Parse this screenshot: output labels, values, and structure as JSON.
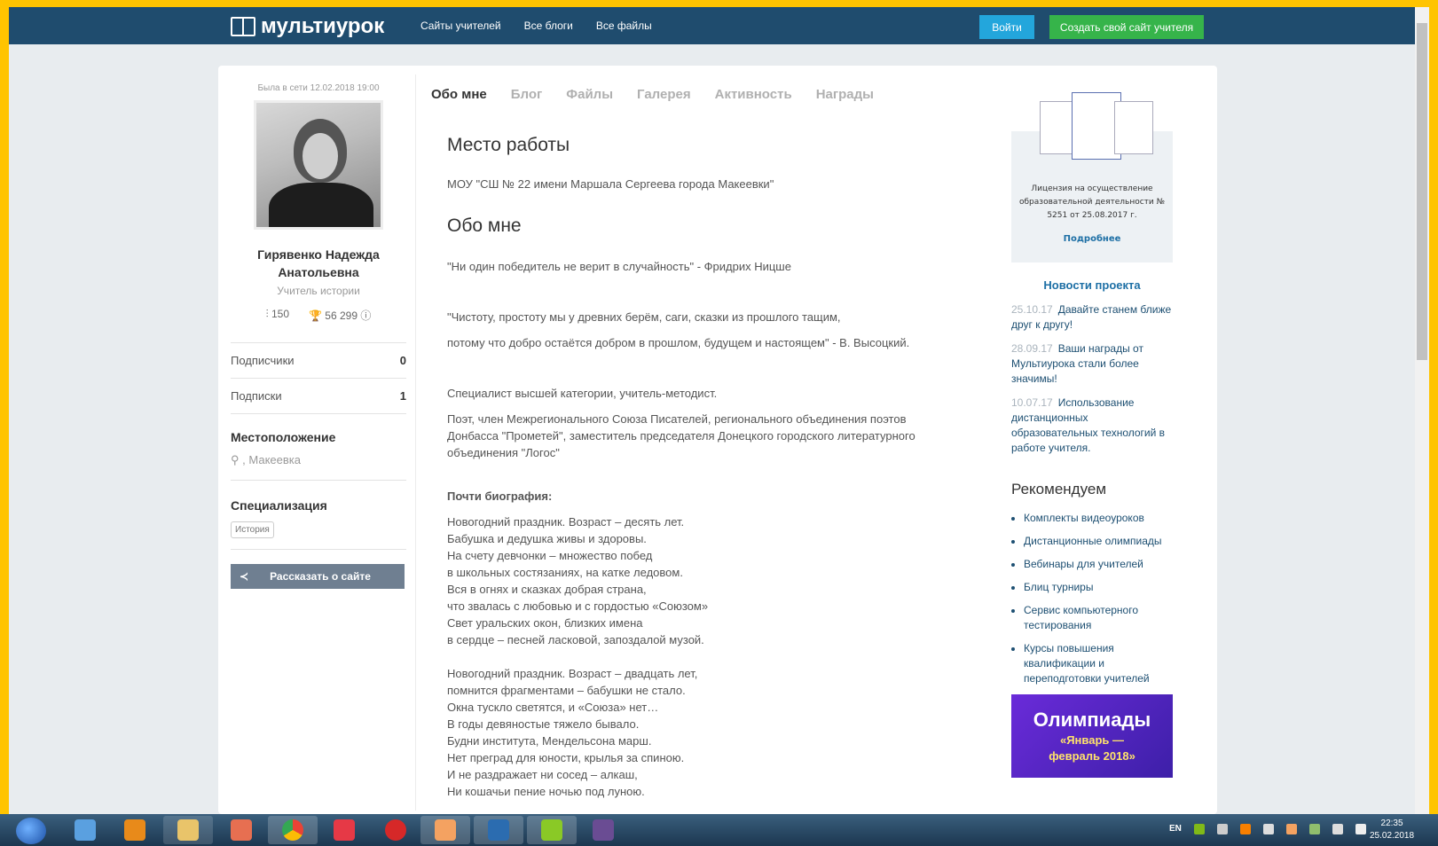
{
  "header": {
    "logo": "мультиурок",
    "nav": [
      "Сайты учителей",
      "Все блоги",
      "Все файлы"
    ],
    "login_label": "Войти",
    "create_label": "Создать свой сайт учителя"
  },
  "profile": {
    "online": "Была в сети 12.02.2018 19:00",
    "name_line1": "Гирявенко Надежда",
    "name_line2": "Анатольевна",
    "role": "Учитель истории",
    "stat_rating": "150",
    "stat_awards": "56 299",
    "subscribers_label": "Подписчики",
    "subscribers_count": "0",
    "subscriptions_label": "Подписки",
    "subscriptions_count": "1",
    "location_title": "Местоположение",
    "location_value": ", Макеевка",
    "spec_title": "Специализация",
    "spec_tag": "История",
    "share_label": "Рассказать о сайте"
  },
  "tabs": [
    "Обо мне",
    "Блог",
    "Файлы",
    "Галерея",
    "Активность",
    "Награды"
  ],
  "main": {
    "work_title": "Место работы",
    "work_value": "МОУ \"СШ № 22 имени Маршала Сергеева города Макеевки\"",
    "about_title": "Обо мне",
    "quote1": " \"Ни один победитель не верит в случайность\" -  Фридрих Ницше",
    "quote2a": " \"Чистоту, простоту мы у древних берём, саги, сказки из прошлого тащим,",
    "quote2b": "потому что добро остаётся добром в прошлом, будущем и настоящем\" -  В. Высоцкий.",
    "spec1": "Специалист высшей категории, учитель-методист.",
    "spec2": "Поэт, член Межрегионального Союза Писателей, регионального объединения поэтов Донбасса \"Прометей\", заместитель председателя Донецкого городского литературного объединения \"Логос\"",
    "bio_title": "Почти биография:",
    "poem1": [
      "Новогодний праздник. Возраст – десять лет.",
      "Бабушка и дедушка живы и здоровы.",
      "На счету девчонки – множество побед",
      "в школьных состязаниях, на катке ледовом.",
      "Вся в огнях и сказках добрая страна,",
      "что звалась с любовью и с гордостью «Союзом»",
      "Свет уральских окон, близких имена",
      "в сердце – песней ласковой, запоздалой музой."
    ],
    "poem2": [
      "Новогодний праздник. Возраст – двадцать лет,",
      "помнится фрагментами – бабушки не стало.",
      "Окна тускло светятся, и «Союза» нет…",
      "В годы девяностые тяжело бывало.",
      "Будни института, Мендельсона марш.",
      "Нет преград для юности, крылья за спиною.",
      "И не раздражает ни сосед – алкаш,",
      "Ни кошачьи пение ночью под луною."
    ]
  },
  "sidebar_right": {
    "license_text": "Лицензия на осуществление образовательной деятельности № 5251 от 25.08.2017 г.",
    "license_link": "Подробнее",
    "news_title": "Новости проекта",
    "news": [
      {
        "date": "25.10.17",
        "text": "Давайте станем ближе друг к другу!"
      },
      {
        "date": "28.09.17",
        "text": "Ваши награды от Мультиурока стали более значимы!"
      },
      {
        "date": "10.07.17",
        "text": "Использование дистанционных образовательных технологий в работе учителя."
      }
    ],
    "rec_title": "Рекомендуем",
    "rec": [
      "Комплекты видеоуроков",
      "Дистанционные олимпиады",
      "Вебинары для учителей",
      "Блиц турниры",
      "Сервис компьютерного тестирования",
      "Курсы повышения квалификации и переподготовки учителей"
    ],
    "olymp_title": "Олимпиады",
    "olymp_sub1": "«Январь —",
    "olymp_sub2": "февраль 2018»"
  },
  "taskbar": {
    "lang": "EN",
    "time": "22:35",
    "date": "25.02.2018"
  }
}
